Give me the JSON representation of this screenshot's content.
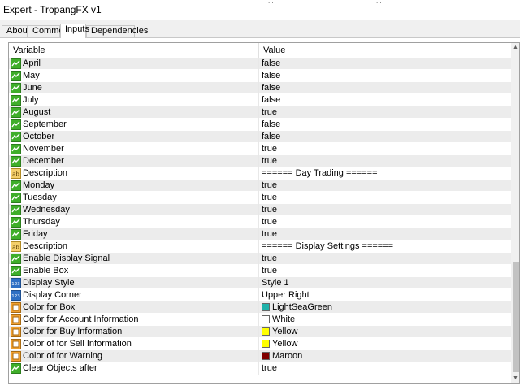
{
  "window": {
    "title": "Expert - TropangFX v1",
    "top_fragment_1": "...",
    "top_fragment_2": "..."
  },
  "tabs": [
    {
      "label": "About"
    },
    {
      "label": "Common"
    },
    {
      "label": "Inputs",
      "active": true
    },
    {
      "label": "Dependencies"
    }
  ],
  "grid": {
    "columns": {
      "variable": "Variable",
      "value": "Value"
    },
    "rows": [
      {
        "variable": "April",
        "value": "false",
        "icon": "bool-icon"
      },
      {
        "variable": "May",
        "value": "false",
        "icon": "bool-icon"
      },
      {
        "variable": "June",
        "value": "false",
        "icon": "bool-icon"
      },
      {
        "variable": "July",
        "value": "false",
        "icon": "bool-icon"
      },
      {
        "variable": "August",
        "value": "true",
        "icon": "bool-icon"
      },
      {
        "variable": "September",
        "value": "false",
        "icon": "bool-icon"
      },
      {
        "variable": "October",
        "value": "false",
        "icon": "bool-icon"
      },
      {
        "variable": "November",
        "value": "true",
        "icon": "bool-icon"
      },
      {
        "variable": "December",
        "value": "true",
        "icon": "bool-icon"
      },
      {
        "variable": "Description",
        "value": "====== Day Trading ======",
        "icon": "string-icon"
      },
      {
        "variable": "Monday",
        "value": "true",
        "icon": "bool-icon"
      },
      {
        "variable": "Tuesday",
        "value": "true",
        "icon": "bool-icon"
      },
      {
        "variable": "Wednesday",
        "value": "true",
        "icon": "bool-icon"
      },
      {
        "variable": "Thursday",
        "value": "true",
        "icon": "bool-icon"
      },
      {
        "variable": "Friday",
        "value": "true",
        "icon": "bool-icon"
      },
      {
        "variable": "Description",
        "value": "====== Display Settings ======",
        "icon": "string-icon"
      },
      {
        "variable": "Enable Display Signal",
        "value": "true",
        "icon": "bool-icon"
      },
      {
        "variable": "Enable Box",
        "value": "true",
        "icon": "bool-icon"
      },
      {
        "variable": "Display Style",
        "value": "Style 1",
        "icon": "enum-icon"
      },
      {
        "variable": "Display Corner",
        "value": "Upper Right",
        "icon": "enum-icon"
      },
      {
        "variable": "Color for Box",
        "value": "LightSeaGreen",
        "icon": "color-icon",
        "swatch": "#20b2aa"
      },
      {
        "variable": "Color for Account Information",
        "value": "White",
        "icon": "color-icon",
        "swatch": "#ffffff"
      },
      {
        "variable": "Color for Buy Information",
        "value": "Yellow",
        "icon": "color-icon",
        "swatch": "#ffff00"
      },
      {
        "variable": "Color of for Sell Information",
        "value": "Yellow",
        "icon": "color-icon",
        "swatch": "#ffff00"
      },
      {
        "variable": "Color of for Warning",
        "value": "Maroon",
        "icon": "color-icon",
        "swatch": "#800000"
      },
      {
        "variable": "Clear Objects after",
        "value": "true",
        "icon": "bool-icon"
      }
    ]
  }
}
